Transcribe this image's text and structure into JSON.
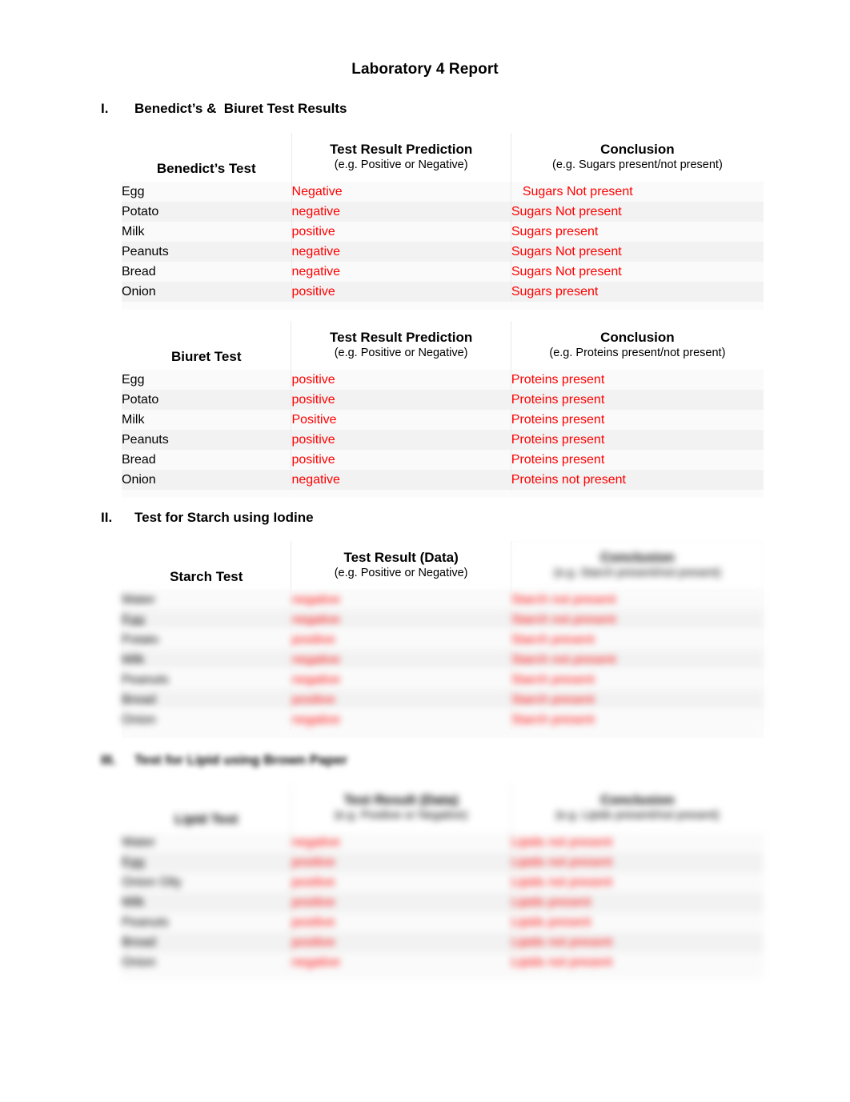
{
  "document": {
    "title": "Laboratory 4 Report"
  },
  "sections": [
    {
      "numeral": "I.",
      "label": "Benedict’s &  Biuret Test Results"
    },
    {
      "numeral": "II.",
      "label": "Test for Starch using Iodine"
    },
    {
      "numeral": "III.",
      "label": "Test for Lipid using Brown Paper"
    }
  ],
  "tables": {
    "benedicts": {
      "headers": {
        "col_a_main": "Benedict’s Test",
        "col_b_main": "Test Result Prediction",
        "col_b_sub": "(e.g. Positive or Negative)",
        "col_c_main": "Conclusion",
        "col_c_sub": "(e.g. Sugars present/not present)"
      },
      "rows": [
        {
          "item": "Egg",
          "prediction": "Negative",
          "conclusion": "Sugars Not present"
        },
        {
          "item": "Potato",
          "prediction": "negative",
          "conclusion": "Sugars Not present"
        },
        {
          "item": "Milk",
          "prediction": "positive",
          "conclusion": "Sugars present"
        },
        {
          "item": "Peanuts",
          "prediction": "negative",
          "conclusion": "Sugars Not present"
        },
        {
          "item": "Bread",
          "prediction": "negative",
          "conclusion": "Sugars Not present"
        },
        {
          "item": "Onion",
          "prediction": "positive",
          "conclusion": "Sugars present"
        }
      ]
    },
    "biuret": {
      "headers": {
        "col_a_main": "Biuret  Test",
        "col_b_main": "Test Result Prediction",
        "col_b_sub": "(e.g. Positive or Negative)",
        "col_c_main": "Conclusion",
        "col_c_sub": "(e.g. Proteins present/not present)"
      },
      "rows": [
        {
          "item": "Egg",
          "prediction": "positive",
          "conclusion": "Proteins present"
        },
        {
          "item": "Potato",
          "prediction": "positive",
          "conclusion": "Proteins present"
        },
        {
          "item": "Milk",
          "prediction": "Positive",
          "conclusion": "Proteins present"
        },
        {
          "item": "Peanuts",
          "prediction": "positive",
          "conclusion": "Proteins present"
        },
        {
          "item": "Bread",
          "prediction": "positive",
          "conclusion": "Proteins present"
        },
        {
          "item": "Onion",
          "prediction": "negative",
          "conclusion": "Proteins not present"
        }
      ]
    },
    "starch": {
      "headers": {
        "col_a_main": "Starch Test",
        "col_b_main": "Test Result (Data)",
        "col_b_sub": "(e.g. Positive or Negative)",
        "col_c_main": "Conclusion",
        "col_c_sub": "(e.g. Starch present/not present)"
      },
      "rows": [
        {
          "item": "Water",
          "prediction": "negative",
          "conclusion": "Starch not present"
        },
        {
          "item": "Egg",
          "prediction": "negative",
          "conclusion": "Starch not present"
        },
        {
          "item": "Potato",
          "prediction": "positive",
          "conclusion": "Starch present"
        },
        {
          "item": "Milk",
          "prediction": "negative",
          "conclusion": "Starch not present"
        },
        {
          "item": "Peanuts",
          "prediction": "negative",
          "conclusion": "Starch present"
        },
        {
          "item": "Bread",
          "prediction": "positive",
          "conclusion": "Starch present"
        },
        {
          "item": "Onion",
          "prediction": "negative",
          "conclusion": "Starch present"
        }
      ]
    },
    "lipid": {
      "headers": {
        "col_a_main": "Lipid Test",
        "col_b_main": "Test Result (Data)",
        "col_b_sub": "(e.g. Positive or Negative)",
        "col_c_main": "Conclusion",
        "col_c_sub": "(e.g. Lipids present/not present)"
      },
      "rows": [
        {
          "item": "Water",
          "prediction": "negative",
          "conclusion": "Lipids not present"
        },
        {
          "item": "Egg",
          "prediction": "positive",
          "conclusion": "Lipids not present"
        },
        {
          "item": "Onion Oily",
          "prediction": "positive",
          "conclusion": "Lipids not present"
        },
        {
          "item": "Milk",
          "prediction": "positive",
          "conclusion": "Lipids present"
        },
        {
          "item": "Peanuts",
          "prediction": "positive",
          "conclusion": "Lipids present"
        },
        {
          "item": "Bread",
          "prediction": "positive",
          "conclusion": "Lipids not present"
        },
        {
          "item": "Onion",
          "prediction": "negative",
          "conclusion": "Lipids not present"
        }
      ]
    }
  },
  "colors": {
    "answer_red": "#ff0000",
    "text_black": "#000000",
    "row_shade": "#f2f2f2",
    "divider": "#e9e9e9"
  }
}
